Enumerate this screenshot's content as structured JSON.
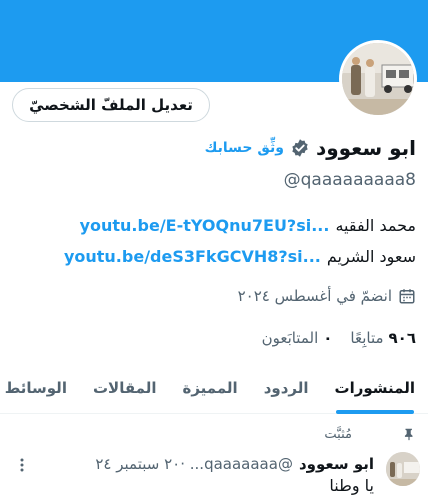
{
  "profile": {
    "edit_button": "تعديل الملفّ الشخصيّ",
    "display_name": "ابو سعوود",
    "verify_link": "وثِّق حسابك",
    "handle": "@qaaaaaaaaa8",
    "bio": [
      {
        "label": "محمد الفقيه",
        "link": "youtu.be/E-tYOQnu7EU?si..."
      },
      {
        "label": "سعود الشريم",
        "link": "youtu.be/deS3FkGCVH8?si..."
      }
    ],
    "joined": "انضمّ في أغسطس ٢٠٢٤",
    "following_count": "٩٠٦",
    "following_label": "متابِعًا",
    "followers_count": "٠",
    "followers_label": "المتابَعون"
  },
  "tabs": [
    "المنشورات",
    "الردود",
    "المميزة",
    "المقالات",
    "الوسائط"
  ],
  "active_tab": 0,
  "pinned_post": {
    "pinned_label": "مُثبَّت",
    "author_name": "ابو سعوود",
    "meta": "@qaaaaaaa... ·٢٠ سبتمبر ٢٤",
    "text": "يا وطنا"
  },
  "colors": {
    "accent": "#1d9bf0",
    "text_primary": "#0f1419",
    "text_secondary": "#536471"
  },
  "icons": {
    "verify": "verified-badge-icon",
    "calendar": "calendar-icon",
    "pin": "pin-icon",
    "more": "more-options-icon"
  }
}
